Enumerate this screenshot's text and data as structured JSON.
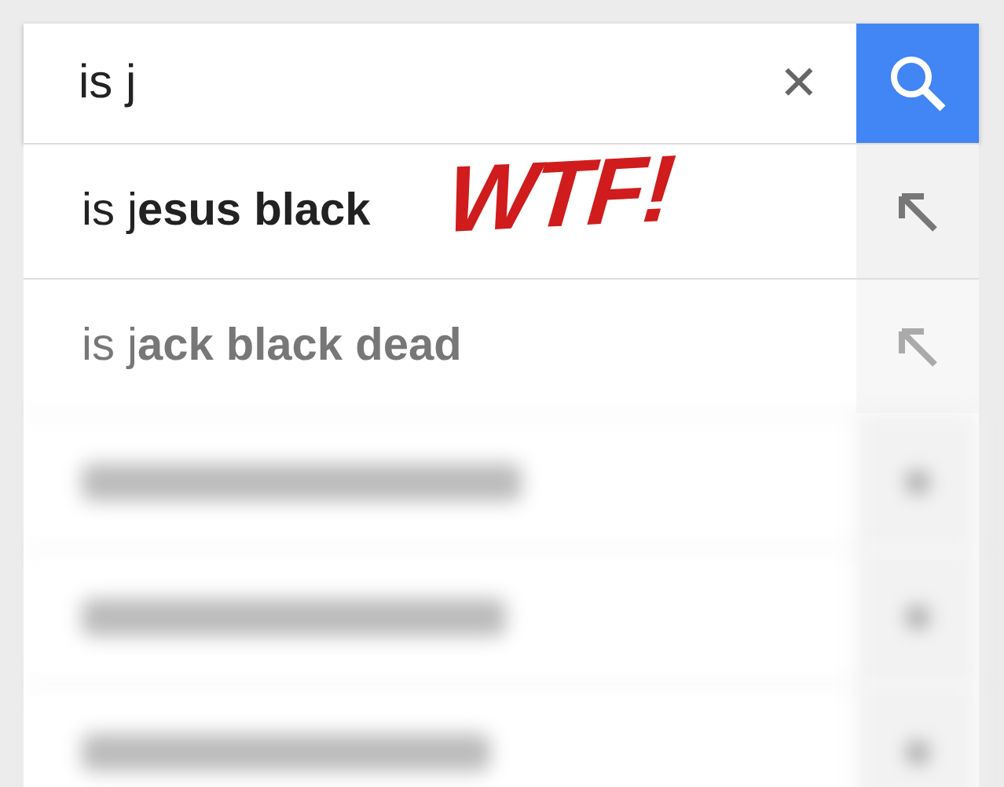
{
  "search": {
    "value": "is j",
    "clear": "✕"
  },
  "overlay": {
    "text": "WTF!"
  },
  "suggestions": [
    {
      "kind": "text",
      "text": "is j**esus black**",
      "dimmed": false
    },
    {
      "kind": "text",
      "text": "is j**ack black dead**",
      "dimmed": true
    },
    {
      "kind": "hidden"
    },
    {
      "kind": "hidden"
    },
    {
      "kind": "hidden"
    }
  ]
}
